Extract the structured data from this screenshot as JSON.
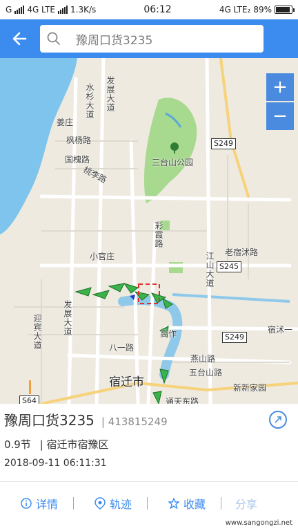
{
  "status": {
    "carrier_left": "G",
    "net_left": "4G LTE",
    "speed": "1.3K/s",
    "time": "06:12",
    "net_right": "4G LTE₂",
    "battery": "89%"
  },
  "header": {
    "search_value": "豫周口货3235",
    "search_icon": "search-icon",
    "back_icon": "arrow-left-icon"
  },
  "map": {
    "labels": {
      "jiangzhuang": "姜庄",
      "fengyangyu": "枫杨路",
      "guohuailu": "国槐路",
      "taolilu": "桃李路",
      "shuishan": "水杉大道",
      "fazhan": "发展大道",
      "santaishan": "三台山公园",
      "s249_top": "S249",
      "xiaoguanzhuang": "小官庄",
      "caixiu": "彩霞路",
      "laosuyi": "老宿沭路",
      "s245": "S245",
      "jiangshan": "江山大道",
      "fazhan2": "发展大道",
      "yingbin": "迎宾大道",
      "bayilu": "八一路",
      "gaozuo": "高作",
      "s249_mid": "S249",
      "suyi": "宿沭一",
      "yanshanlu": "燕山路",
      "wutaishan": "五台山路",
      "xinjiayuan": "新新家园",
      "suqianshi": "宿迁市",
      "s64": "S64",
      "tongtian": "通天东路"
    },
    "zoom_in": "+",
    "zoom_out": "−"
  },
  "vessel": {
    "plate": "豫周口货3235",
    "mmsi": "413815249",
    "speed": "0.9节",
    "location": "宿迁市宿豫区",
    "timestamp": "2018-09-11 06:11:31"
  },
  "actions": {
    "details": "详情",
    "track": "轨迹",
    "favorite": "收藏",
    "more": "分享"
  },
  "watermark": "www.sangongzi.net",
  "colors": {
    "header": "#3c8cf0",
    "accent": "#3c8cf0",
    "zoom": "#4a8bdf",
    "water": "#7ec4ec",
    "park": "#a7d98e"
  }
}
